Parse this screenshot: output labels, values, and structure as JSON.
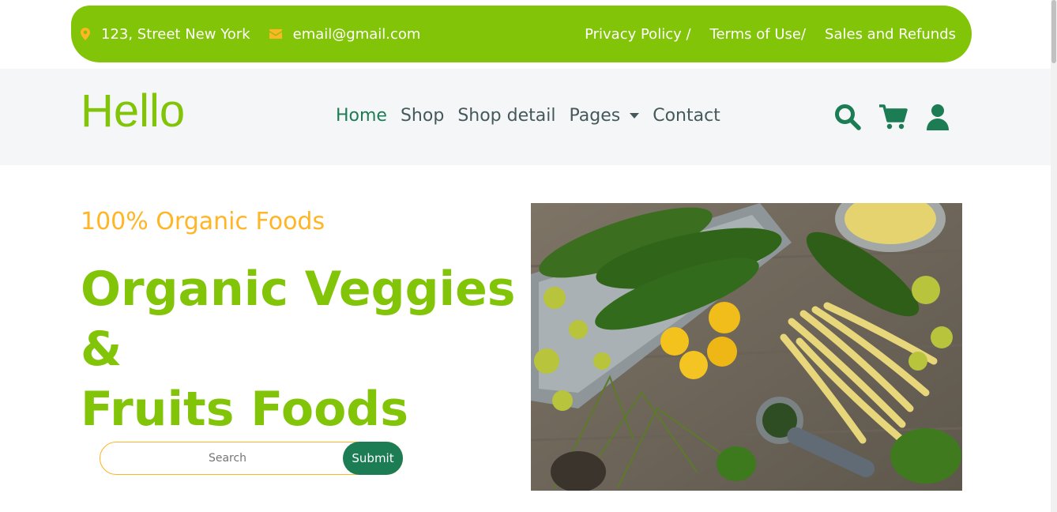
{
  "topbar": {
    "address": "123, Street New York",
    "email": "email@gmail.com",
    "links": [
      "Privacy Policy /",
      "Terms of Use/",
      "Sales and Refunds"
    ],
    "bg_color": "#81c408",
    "icon_color": "#ffb524"
  },
  "navbar": {
    "brand": "Hello",
    "links": [
      "Home",
      "Shop",
      "Shop detail",
      "Pages",
      "Contact"
    ],
    "active_link": "Home",
    "icons": [
      "search-icon",
      "cart-icon",
      "user-icon"
    ]
  },
  "hero": {
    "subtitle": "100% Organic Foods",
    "title_lines": [
      "Organic Veggies",
      "&",
      "Fruits Foods"
    ],
    "search": {
      "placeholder": "Search",
      "button_label": "Submit"
    },
    "image": "vegetables-on-wooden-table"
  },
  "colors": {
    "primary": "#81c408",
    "secondary": "#ffb524",
    "dark_green": "#1c7c54",
    "text": "#45595b",
    "navbar_bg": "#f4f6f8"
  }
}
